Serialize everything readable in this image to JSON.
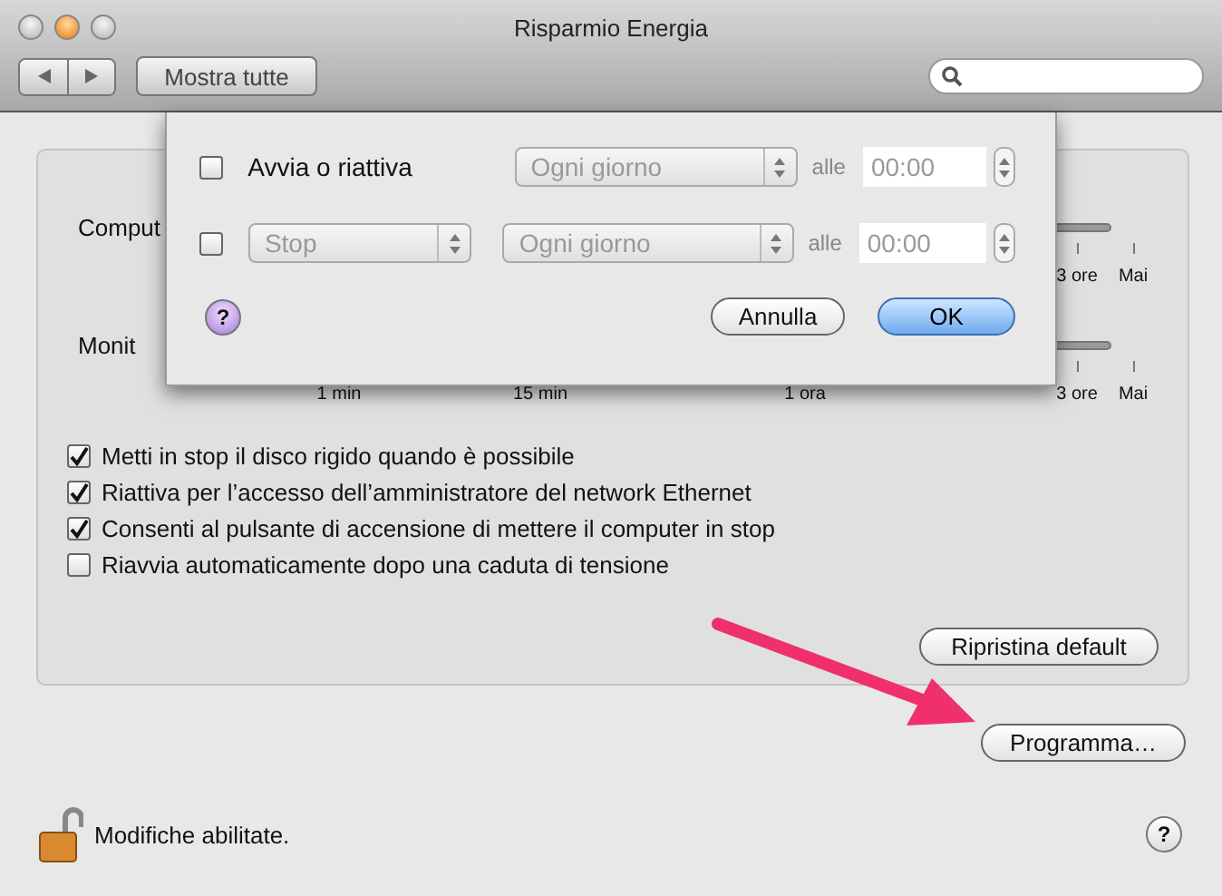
{
  "window": {
    "title": "Risparmio Energia"
  },
  "toolbar": {
    "show_all": "Mostra tutte"
  },
  "sliders": [
    {
      "label": "Comput",
      "ticks": [
        "3 ore",
        "Mai"
      ]
    },
    {
      "label": "Monit",
      "ticks": [
        "1 min",
        "15 min",
        "1 ora",
        "3 ore",
        "Mai"
      ]
    }
  ],
  "options": [
    {
      "label": "Metti in stop il disco rigido quando è possibile",
      "checked": true
    },
    {
      "label": "Riattiva per l’accesso dell’amministratore del network Ethernet",
      "checked": true
    },
    {
      "label": "Consenti al pulsante di accensione di mettere il computer in stop",
      "checked": true
    },
    {
      "label": "Riavvia automaticamente dopo una caduta di tensione",
      "checked": false
    }
  ],
  "restore_button": "Ripristina default",
  "schedule_button": "Programma…",
  "footer": {
    "lock_text": "Modifiche abilitate.",
    "locked": false,
    "help": "?"
  },
  "sheet": {
    "rows": [
      {
        "kind": "label",
        "checked": false,
        "label": "Avvia o riattiva",
        "day": "Ogni giorno",
        "at": "alle",
        "time": "00:00",
        "disabled": true
      },
      {
        "kind": "popup",
        "checked": false,
        "action": "Stop",
        "day": "Ogni giorno",
        "at": "alle",
        "time": "00:00",
        "disabled": true
      }
    ],
    "help": "?",
    "cancel": "Annulla",
    "ok": "OK"
  }
}
